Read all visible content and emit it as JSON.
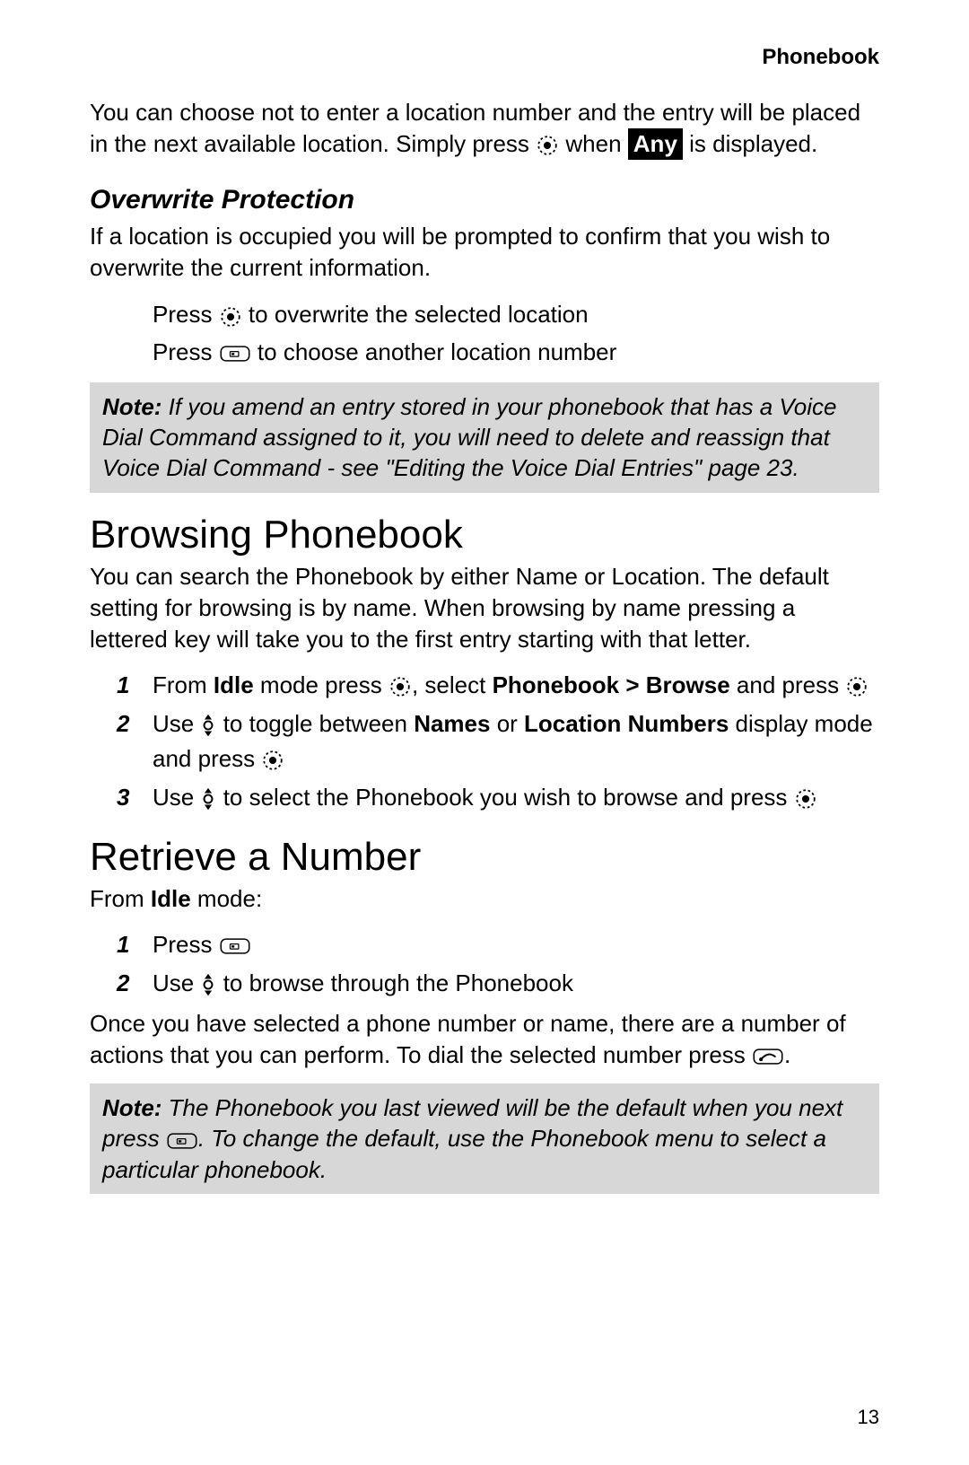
{
  "header": {
    "title": "Phonebook"
  },
  "intro": {
    "p1a": "You can choose not to enter a location number and the entry will be placed in the next available location. Simply press ",
    "p1b": " when ",
    "any": "Any",
    "p1c": " is displayed."
  },
  "overwrite": {
    "heading": "Overwrite Protection",
    "para": "If a location is occupied you will be prompted to confirm that you wish to overwrite the current information.",
    "line1a": "Press ",
    "line1b": " to overwrite the selected location",
    "line2a": "Press ",
    "line2b": " to choose another location number"
  },
  "note1": {
    "label": "Note:",
    "text": " If you amend an entry stored in your phonebook that has a Voice Dial Command assigned to it, you will need to delete and reassign that Voice Dial Command - see \"Editing the Voice Dial Entries\" page 23."
  },
  "browsing": {
    "heading": "Browsing Phonebook",
    "para": "You can search the Phonebook by either Name or Location. The default setting for browsing is by name. When browsing by name pressing a lettered key will take you to the first entry starting with that letter.",
    "s1": {
      "num": "1",
      "a": "From ",
      "idle": "Idle",
      "b": " mode press ",
      "c": ", select ",
      "path": "Phonebook > Browse",
      "d": " and press "
    },
    "s2": {
      "num": "2",
      "a": "Use ",
      "b": " to toggle between ",
      "names": "Names",
      "or": " or ",
      "loc": "Location Numbers",
      "c": " display mode and press "
    },
    "s3": {
      "num": "3",
      "a": "Use ",
      "b": " to select the Phonebook you wish to browse and press "
    }
  },
  "retrieve": {
    "heading": "Retrieve a Number",
    "intro_a": "From ",
    "intro_idle": "Idle",
    "intro_b": " mode:",
    "s1": {
      "num": "1",
      "a": "Press "
    },
    "s2": {
      "num": "2",
      "a": "Use ",
      "b": " to browse through the Phonebook"
    },
    "tail_a": "Once you have selected a phone number or name, there are a number of actions that you can perform. To dial the selected number press ",
    "tail_b": "."
  },
  "note2": {
    "label": "Note:",
    "a": " The Phonebook you last viewed will be the default when you next press ",
    "b": ". To change the default, use the Phonebook menu to select a particular phonebook."
  },
  "page_number": "13"
}
